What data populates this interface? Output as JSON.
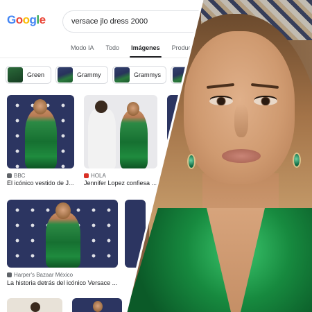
{
  "google": {
    "logo_letters": [
      {
        "char": "G",
        "color": "#4285F4"
      },
      {
        "char": "o",
        "color": "#EA4335"
      },
      {
        "char": "o",
        "color": "#FBBC05"
      },
      {
        "char": "g",
        "color": "#4285F4"
      },
      {
        "char": "l",
        "color": "#34A853"
      },
      {
        "char": "e",
        "color": "#EA4335"
      }
    ]
  },
  "search": {
    "query": "versace jlo dress 2000"
  },
  "tabs": [
    {
      "label": "Modo IA",
      "active": false
    },
    {
      "label": "Todo",
      "active": false
    },
    {
      "label": "Imágenes",
      "active": true
    },
    {
      "label": "Productos",
      "active": false
    }
  ],
  "chips": [
    {
      "label": "Green"
    },
    {
      "label": "Grammy"
    },
    {
      "label": "Grammys"
    }
  ],
  "results": [
    {
      "source": "BBC",
      "source_color": "#5f6368",
      "caption": "El icónico vestido de J..."
    },
    {
      "source": "HOLA",
      "source_color": "#d93025",
      "caption": "Jennifer Lopez confiesa ..."
    },
    {
      "source": "Harper's Bazaar México",
      "source_color": "#5f6368",
      "caption": "La historia detrás del icónico Versace ..."
    }
  ]
}
